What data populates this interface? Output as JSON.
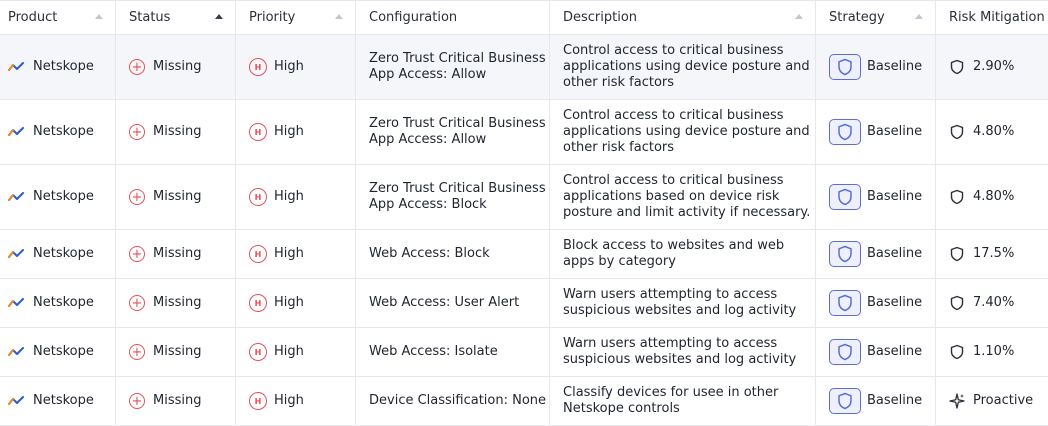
{
  "columns": [
    {
      "label": "Product"
    },
    {
      "label": "Status"
    },
    {
      "label": "Priority"
    },
    {
      "label": "Configuration"
    },
    {
      "label": "Description"
    },
    {
      "label": "Strategy"
    },
    {
      "label": "Risk Mitigation"
    }
  ],
  "rows": [
    {
      "product": "Netskope",
      "status": "Missing",
      "priority": "High",
      "priority_code": "H",
      "config": "Zero Trust Critical Business App Access: Allow",
      "description": "Control access to critical business applications using device posture and other risk factors",
      "strategy": "Baseline",
      "risk": "2.90%"
    },
    {
      "product": "Netskope",
      "status": "Missing",
      "priority": "High",
      "priority_code": "H",
      "config": "Zero Trust Critical Business App Access: Allow",
      "description": "Control access to critical business applications using device posture and other risk factors",
      "strategy": "Baseline",
      "risk": "4.80%"
    },
    {
      "product": "Netskope",
      "status": "Missing",
      "priority": "High",
      "priority_code": "H",
      "config": "Zero Trust Critical Business App Access: Block",
      "description": "Control access to critical business applications based on device risk posture and limit activity if necessary.",
      "strategy": "Baseline",
      "risk": "4.80%"
    },
    {
      "product": "Netskope",
      "status": "Missing",
      "priority": "High",
      "priority_code": "H",
      "config": "Web Access: Block",
      "description": "Block access to websites and web apps by category",
      "strategy": "Baseline",
      "risk": "17.5%"
    },
    {
      "product": "Netskope",
      "status": "Missing",
      "priority": "High",
      "priority_code": "H",
      "config": "Web Access: User Alert",
      "description": "Warn users attempting to access suspicious websites and log activity",
      "strategy": "Baseline",
      "risk": "7.40%"
    },
    {
      "product": "Netskope",
      "status": "Missing",
      "priority": "High",
      "priority_code": "H",
      "config": "Web Access: Isolate",
      "description": "Warn users attempting to access suspicious websites and log activity",
      "strategy": "Baseline",
      "risk": "1.10%"
    },
    {
      "product": "Netskope",
      "status": "Missing",
      "priority": "High",
      "priority_code": "H",
      "config": "Device Classification: None",
      "description": "Classify devices for usee in other Netskope controls",
      "strategy": "Baseline",
      "risk": "Proactive"
    }
  ],
  "colors": {
    "danger": "#e2525a",
    "accent": "#5d6fd6",
    "product_icon": [
      "#f08a24",
      "#2a5bd7"
    ]
  },
  "icons": {
    "status": "plus-circle-icon",
    "priority": "priority-badge-icon",
    "strategy": "shield-icon",
    "risk": "shield-outline-icon",
    "proactive": "sparkle-icon",
    "product": "netskope-logo-icon"
  }
}
